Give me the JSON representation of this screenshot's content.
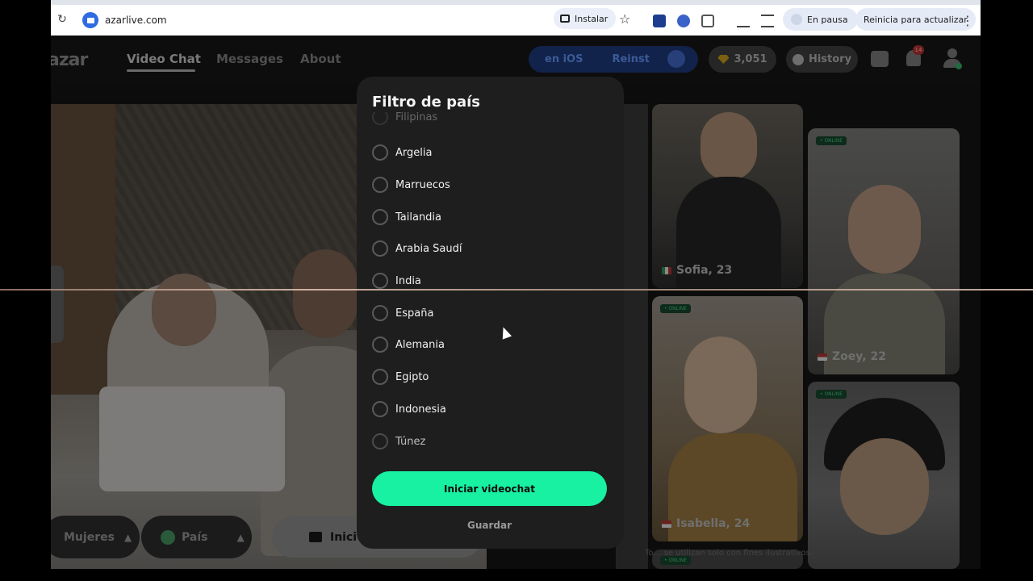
{
  "browser": {
    "url": "azarlive.com",
    "install_label": "Instalar",
    "paused_label": "En pausa",
    "update_label": "Reinicia para actualizar"
  },
  "nav": {
    "logo": "azar",
    "links": [
      "Video Chat",
      "Messages",
      "About"
    ],
    "promo_left": "en iOS",
    "promo_right": "Reinst",
    "coins": "3,051",
    "history_label": "History",
    "notif_count": "14"
  },
  "controls": {
    "gender_label": "Mujeres",
    "country_label": "País",
    "start_label": "Inici"
  },
  "cards": [
    {
      "name": "Sofia, 23"
    },
    {
      "name": "Zoey, 22",
      "online": "• ONLINE"
    },
    {
      "name": "Isabella, 24",
      "online": "• ONLINE"
    },
    {
      "online": "• ONLINE"
    },
    {
      "online": "• ONLINE"
    }
  ],
  "disclaimer": "To… se utilizan solo con fines ilustrativos.",
  "modal": {
    "title": "Filtro de país",
    "countries": [
      "Filipinas",
      "Argelia",
      "Marruecos",
      "Tailandia",
      "Arabia Saudí",
      "India",
      "España",
      "Alemania",
      "Egipto",
      "Indonesia",
      "Túnez"
    ],
    "primary_label": "Iniciar videochat",
    "secondary_label": "Guardar"
  },
  "colors": {
    "accent": "#18f0a2",
    "modal_bg": "#1e1e1e"
  }
}
